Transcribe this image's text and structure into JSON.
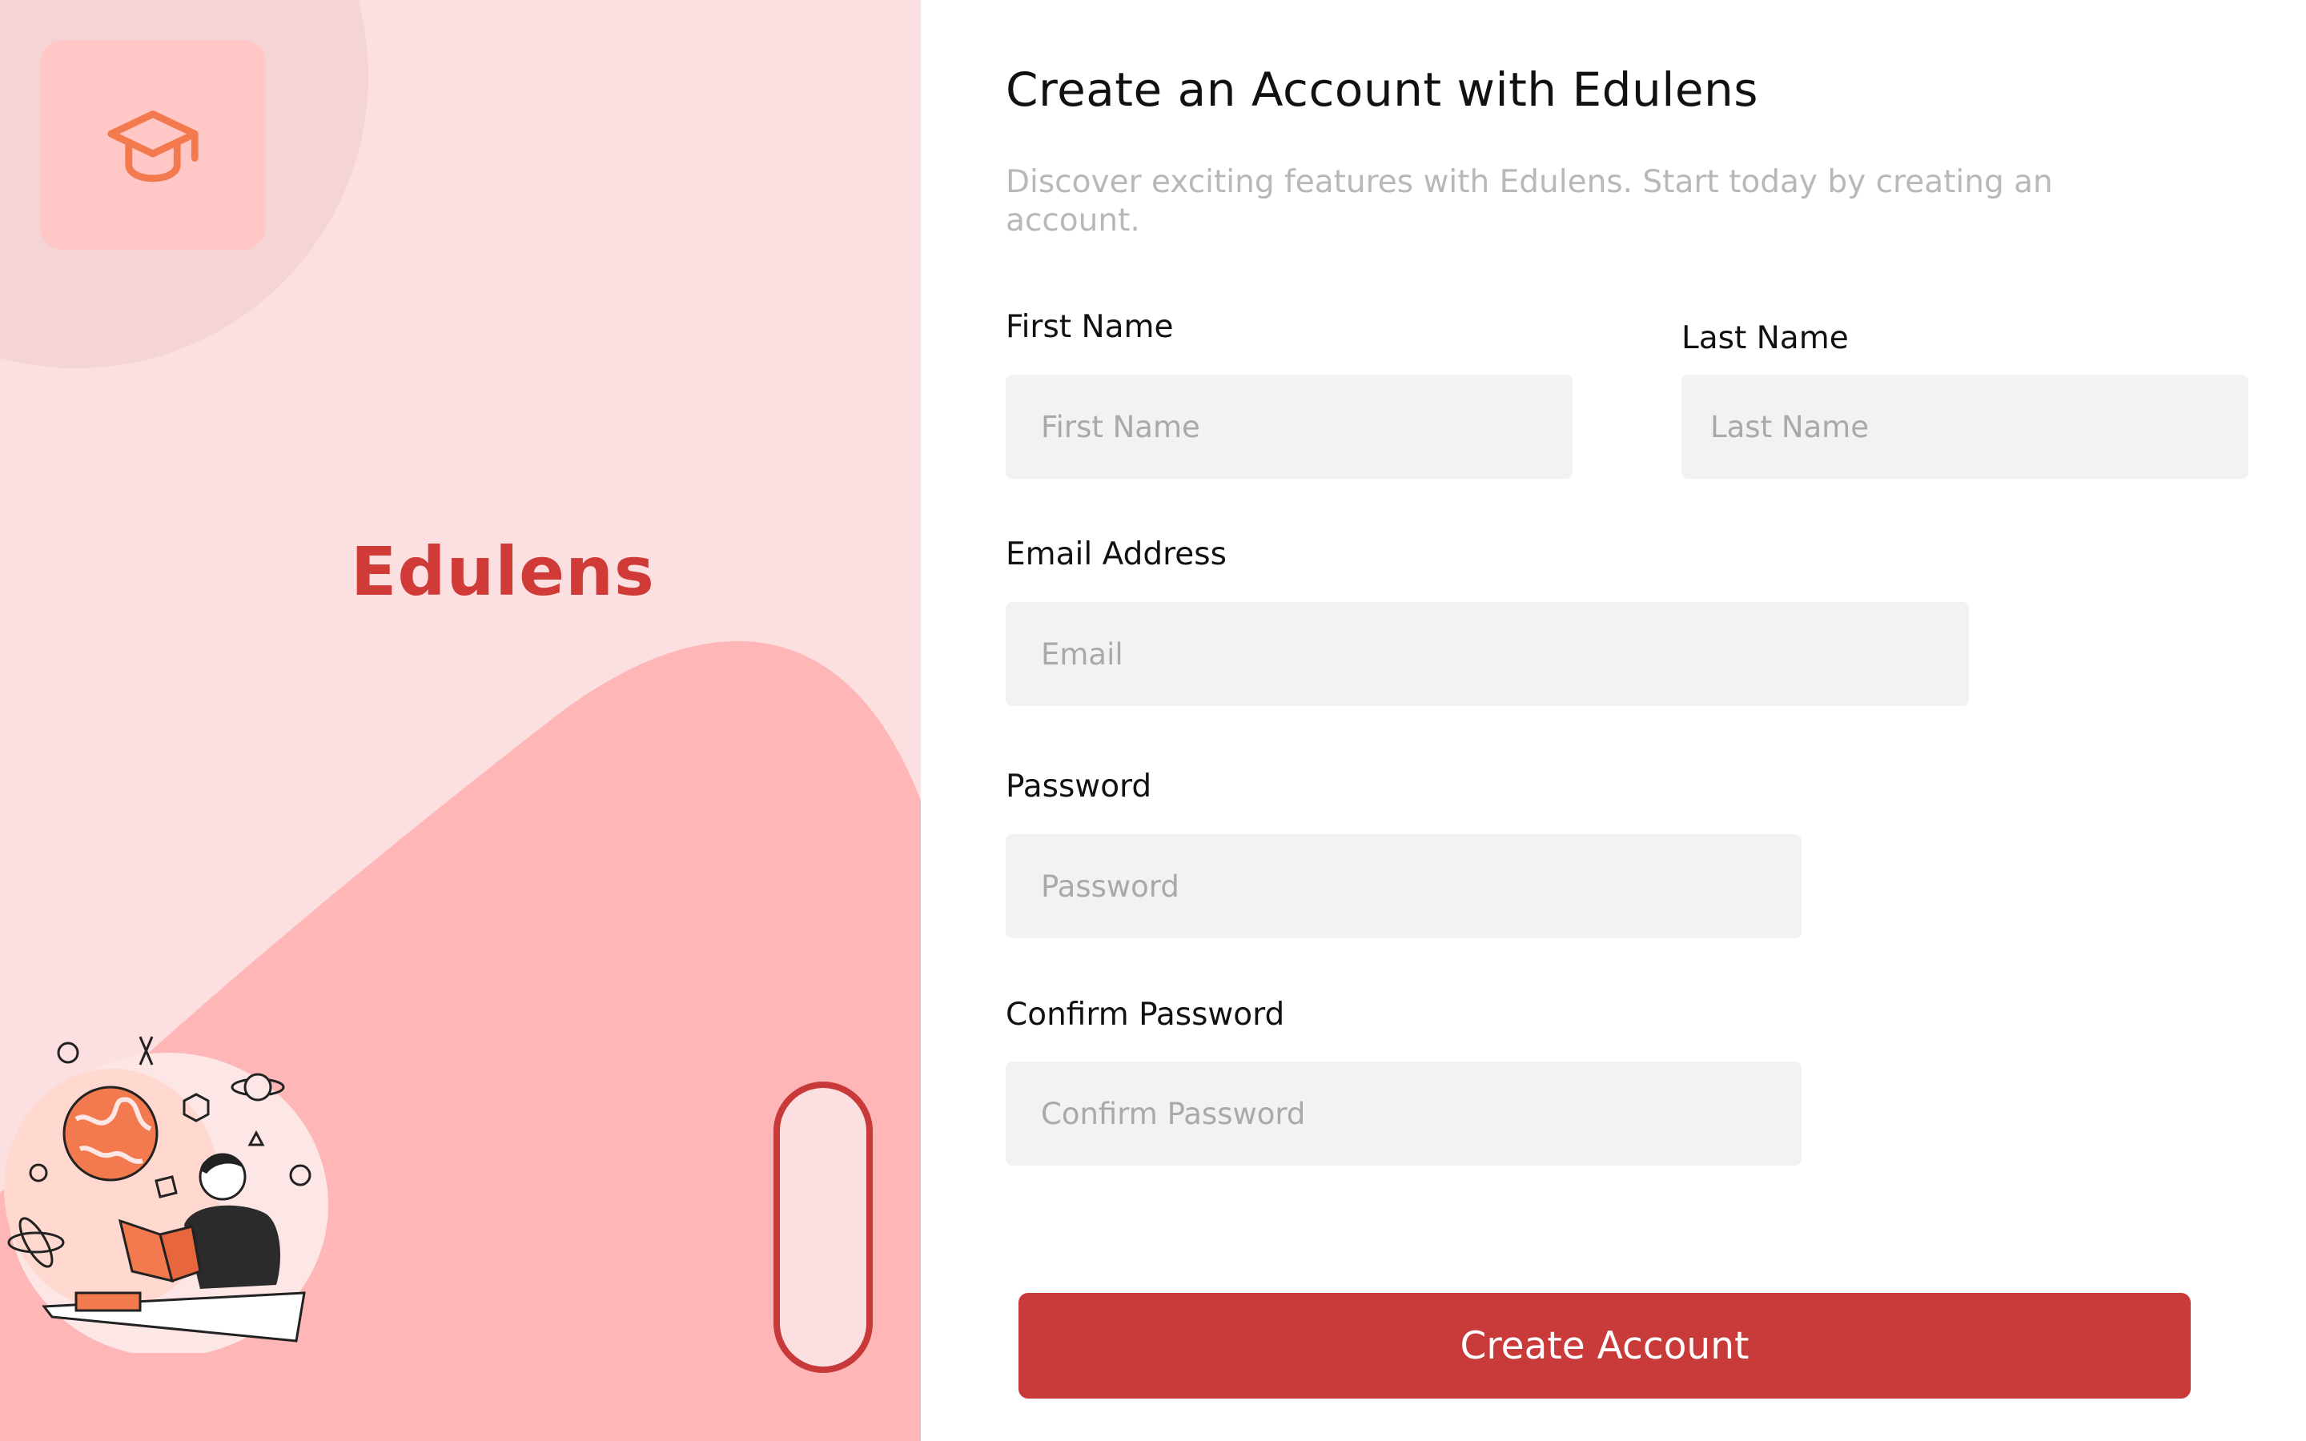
{
  "brand": {
    "name": "Edulens",
    "logo_icon": "graduation-cap-icon"
  },
  "form": {
    "title": "Create an Account with Edulens",
    "subtitle": "Discover exciting features with Edulens. Start today by creating an account.",
    "fields": {
      "first_name": {
        "label": "First Name",
        "placeholder": "First Name",
        "value": ""
      },
      "last_name": {
        "label": "Last Name",
        "placeholder": "Last Name",
        "value": ""
      },
      "email": {
        "label": "Email Address",
        "placeholder": "Email",
        "value": ""
      },
      "password": {
        "label": "Password",
        "placeholder": "Password",
        "value": ""
      },
      "confirm_password": {
        "label": "Confirm Password",
        "placeholder": "Confirm Password",
        "value": ""
      }
    },
    "submit_label": "Create Account"
  },
  "colors": {
    "accent": "#c93b3b",
    "brand_text": "#d03a37",
    "left_bg": "#fcdfe0",
    "blob": "#ffb6b6",
    "logo_icon": "#f37a4e",
    "input_bg": "#f2f2f2"
  }
}
